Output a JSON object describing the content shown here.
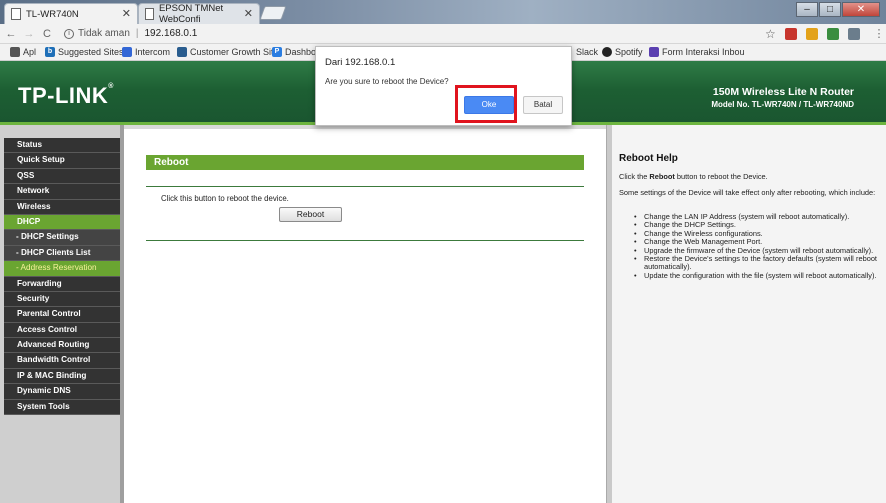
{
  "browser": {
    "tabs": [
      {
        "title": "TL-WR740N",
        "active": true
      },
      {
        "title": "EPSON TMNet WebConfi",
        "active": false
      }
    ],
    "address": {
      "security_label": "Tidak aman",
      "url": "192.168.0.1"
    },
    "bookmarks": [
      {
        "label": "Apl",
        "icon_color": "#555555"
      },
      {
        "label": "Suggested Sites",
        "icon_color": "#1e6fb8"
      },
      {
        "label": "Intercom",
        "icon_color": "#3367d6"
      },
      {
        "label": "Customer Growth Sit",
        "icon_color": "#2a5d8f"
      },
      {
        "label": "Dashbo",
        "icon_color": "#2a7de1"
      },
      {
        "label": "Slack",
        "icon_color": "#444444"
      },
      {
        "label": "Spotify",
        "icon_color": "#222222"
      },
      {
        "label": "Form Interaksi Inbou",
        "icon_color": "#5a3fb0"
      }
    ]
  },
  "router": {
    "logo": "TP-LINK",
    "logo_mark": "®",
    "model_line1": "150M Wireless Lite N Router",
    "model_line2": "Model No. TL-WR740N / TL-WR740ND",
    "menu": [
      {
        "label": "Status",
        "style": "normal"
      },
      {
        "label": "Quick Setup",
        "style": "normal"
      },
      {
        "label": "QSS",
        "style": "normal"
      },
      {
        "label": "Network",
        "style": "normal"
      },
      {
        "label": "Wireless",
        "style": "normal"
      },
      {
        "label": "DHCP",
        "style": "active"
      },
      {
        "label": "- DHCP Settings",
        "style": "sub"
      },
      {
        "label": "- DHCP Clients List",
        "style": "sub"
      },
      {
        "label": "- Address Reservation",
        "style": "subact"
      },
      {
        "label": "Forwarding",
        "style": "normal"
      },
      {
        "label": "Security",
        "style": "normal"
      },
      {
        "label": "Parental Control",
        "style": "normal"
      },
      {
        "label": "Access Control",
        "style": "normal"
      },
      {
        "label": "Advanced Routing",
        "style": "normal"
      },
      {
        "label": "Bandwidth Control",
        "style": "normal"
      },
      {
        "label": "IP & MAC Binding",
        "style": "normal"
      },
      {
        "label": "Dynamic DNS",
        "style": "normal"
      },
      {
        "label": "System Tools",
        "style": "normal"
      }
    ],
    "content": {
      "section_title": "Reboot",
      "instruction": "Click this button to reboot the device.",
      "reboot_button": "Reboot"
    },
    "help": {
      "title": "Reboot Help",
      "p1_pre": "Click the ",
      "p1_bold": "Reboot",
      "p1_post": " button to reboot the Device.",
      "p2": "Some settings of the Device will take effect only after rebooting, which include:",
      "items": [
        "Change the LAN IP Address (system will reboot automatically).",
        "Change the DHCP Settings.",
        "Change the Wireless configurations.",
        "Change the Web Management Port.",
        "Upgrade the firmware of the Device (system will reboot automatically).",
        "Restore the Device's settings to the factory defaults (system will reboot automatically).",
        "Update the configuration with the file (system will reboot automatically)."
      ]
    }
  },
  "dialog": {
    "title": "Dari 192.168.0.1",
    "message": "Are you sure to reboot the Device?",
    "ok_label": "Oke",
    "cancel_label": "Batal",
    "highlight_color": "#e0141e"
  }
}
